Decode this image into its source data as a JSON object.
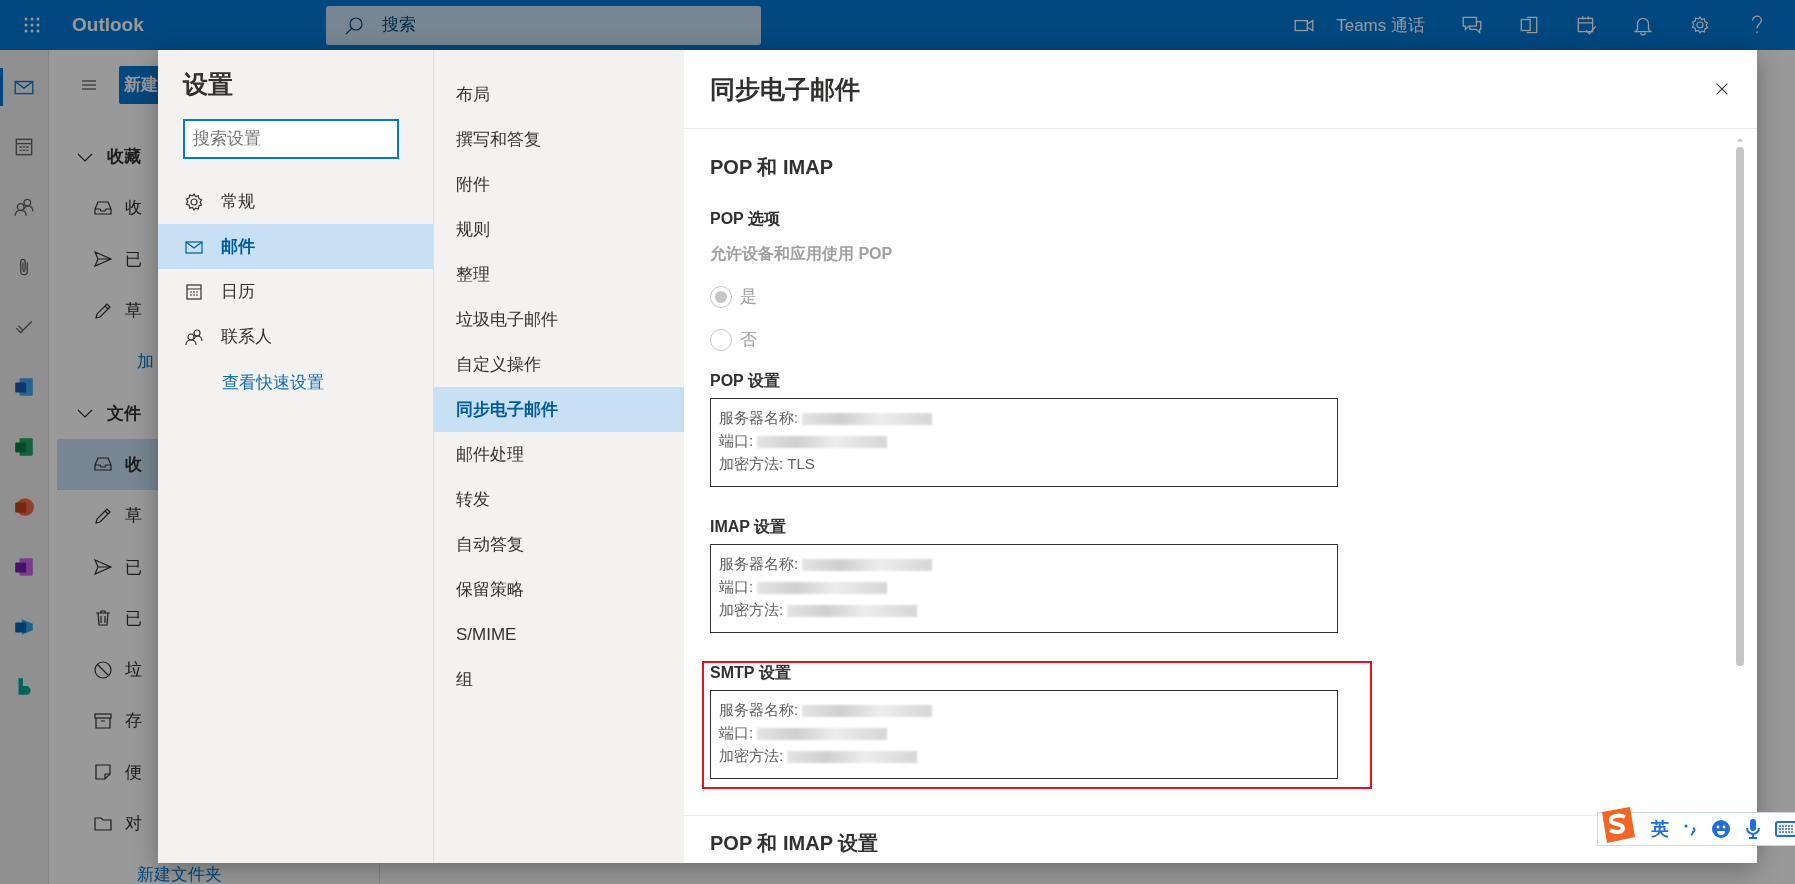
{
  "topbar": {
    "app_name": "Outlook",
    "search": {
      "placeholder": "搜索"
    },
    "teams_call": "Teams 通话"
  },
  "app_rail": {
    "items": [
      {
        "selected": true
      },
      {
        "selected": false
      },
      {
        "selected": false
      },
      {
        "selected": false
      },
      {
        "selected": false
      },
      {
        "selected": false
      },
      {
        "selected": false
      },
      {
        "selected": false
      },
      {
        "selected": false
      },
      {
        "selected": false
      },
      {
        "selected": false
      }
    ]
  },
  "folder_pane": {
    "new_button": "新建",
    "sections": [
      {
        "label": "收藏",
        "expanded": true,
        "items": [
          {
            "kind": "folder",
            "label": "收",
            "selected": false
          },
          {
            "kind": "folder",
            "label": "已",
            "selected": false
          },
          {
            "kind": "folder",
            "label": "草",
            "selected": false
          },
          {
            "kind": "link",
            "label": "加",
            "selected": false
          }
        ]
      },
      {
        "label": "文件",
        "expanded": true,
        "items": [
          {
            "kind": "folder",
            "label": "收",
            "selected": true
          },
          {
            "kind": "folder",
            "label": "草",
            "selected": false
          },
          {
            "kind": "folder",
            "label": "已",
            "selected": false
          },
          {
            "kind": "folder",
            "label": "已",
            "selected": false
          },
          {
            "kind": "folder",
            "label": "垃",
            "selected": false
          },
          {
            "kind": "folder",
            "label": "存",
            "selected": false
          },
          {
            "kind": "folder",
            "label": "便",
            "selected": false
          },
          {
            "kind": "folder",
            "label": "对",
            "selected": false
          },
          {
            "kind": "link",
            "label": "新建文件夹",
            "selected": false
          }
        ]
      }
    ]
  },
  "settings": {
    "title": "设置",
    "search": {
      "placeholder": "搜索设置"
    },
    "categories": [
      {
        "label": "常规",
        "selected": false
      },
      {
        "label": "邮件",
        "selected": true
      },
      {
        "label": "日历",
        "selected": false
      },
      {
        "label": "联系人",
        "selected": false
      }
    ],
    "quick_settings_link": "查看快速设置",
    "subcategories": [
      {
        "label": "布局",
        "selected": false
      },
      {
        "label": "撰写和答复",
        "selected": false
      },
      {
        "label": "附件",
        "selected": false
      },
      {
        "label": "规则",
        "selected": false
      },
      {
        "label": "整理",
        "selected": false
      },
      {
        "label": "垃圾电子邮件",
        "selected": false
      },
      {
        "label": "自定义操作",
        "selected": false
      },
      {
        "label": "同步电子邮件",
        "selected": true
      },
      {
        "label": "邮件处理",
        "selected": false
      },
      {
        "label": "转发",
        "selected": false
      },
      {
        "label": "自动答复",
        "selected": false
      },
      {
        "label": "保留策略",
        "selected": false
      },
      {
        "label": "S/MIME",
        "selected": false
      },
      {
        "label": "组",
        "selected": false
      }
    ]
  },
  "page": {
    "title": "同步电子邮件",
    "heading": "POP 和 IMAP",
    "blocks": [
      {
        "kind": "options",
        "title": "POP 选项",
        "description": "允许设备和应用使用 POP",
        "disabled": true,
        "options": [
          {
            "label": "是",
            "selected": true
          },
          {
            "label": "否",
            "selected": false
          }
        ]
      },
      {
        "kind": "settings",
        "title": "POP 设置",
        "highlighted": false,
        "lines": [
          {
            "label": "服务器名称:",
            "redacted": true
          },
          {
            "label": "端口:",
            "redacted": true
          },
          {
            "label": "加密方法: TLS",
            "redacted": false
          }
        ]
      },
      {
        "kind": "settings",
        "title": "IMAP 设置",
        "highlighted": false,
        "lines": [
          {
            "label": "服务器名称:",
            "redacted": true
          },
          {
            "label": "端口:",
            "redacted": true
          },
          {
            "label": "加密方法:",
            "redacted": true
          }
        ]
      },
      {
        "kind": "settings",
        "title": "SMTP 设置",
        "highlighted": true,
        "lines": [
          {
            "label": "服务器名称:",
            "redacted": true
          },
          {
            "label": "端口:",
            "redacted": true
          },
          {
            "label": "加密方法:",
            "redacted": true
          }
        ]
      }
    ],
    "next_heading": "POP 和 IMAP 设置"
  },
  "ime_toolbar": {
    "mode": "英"
  }
}
